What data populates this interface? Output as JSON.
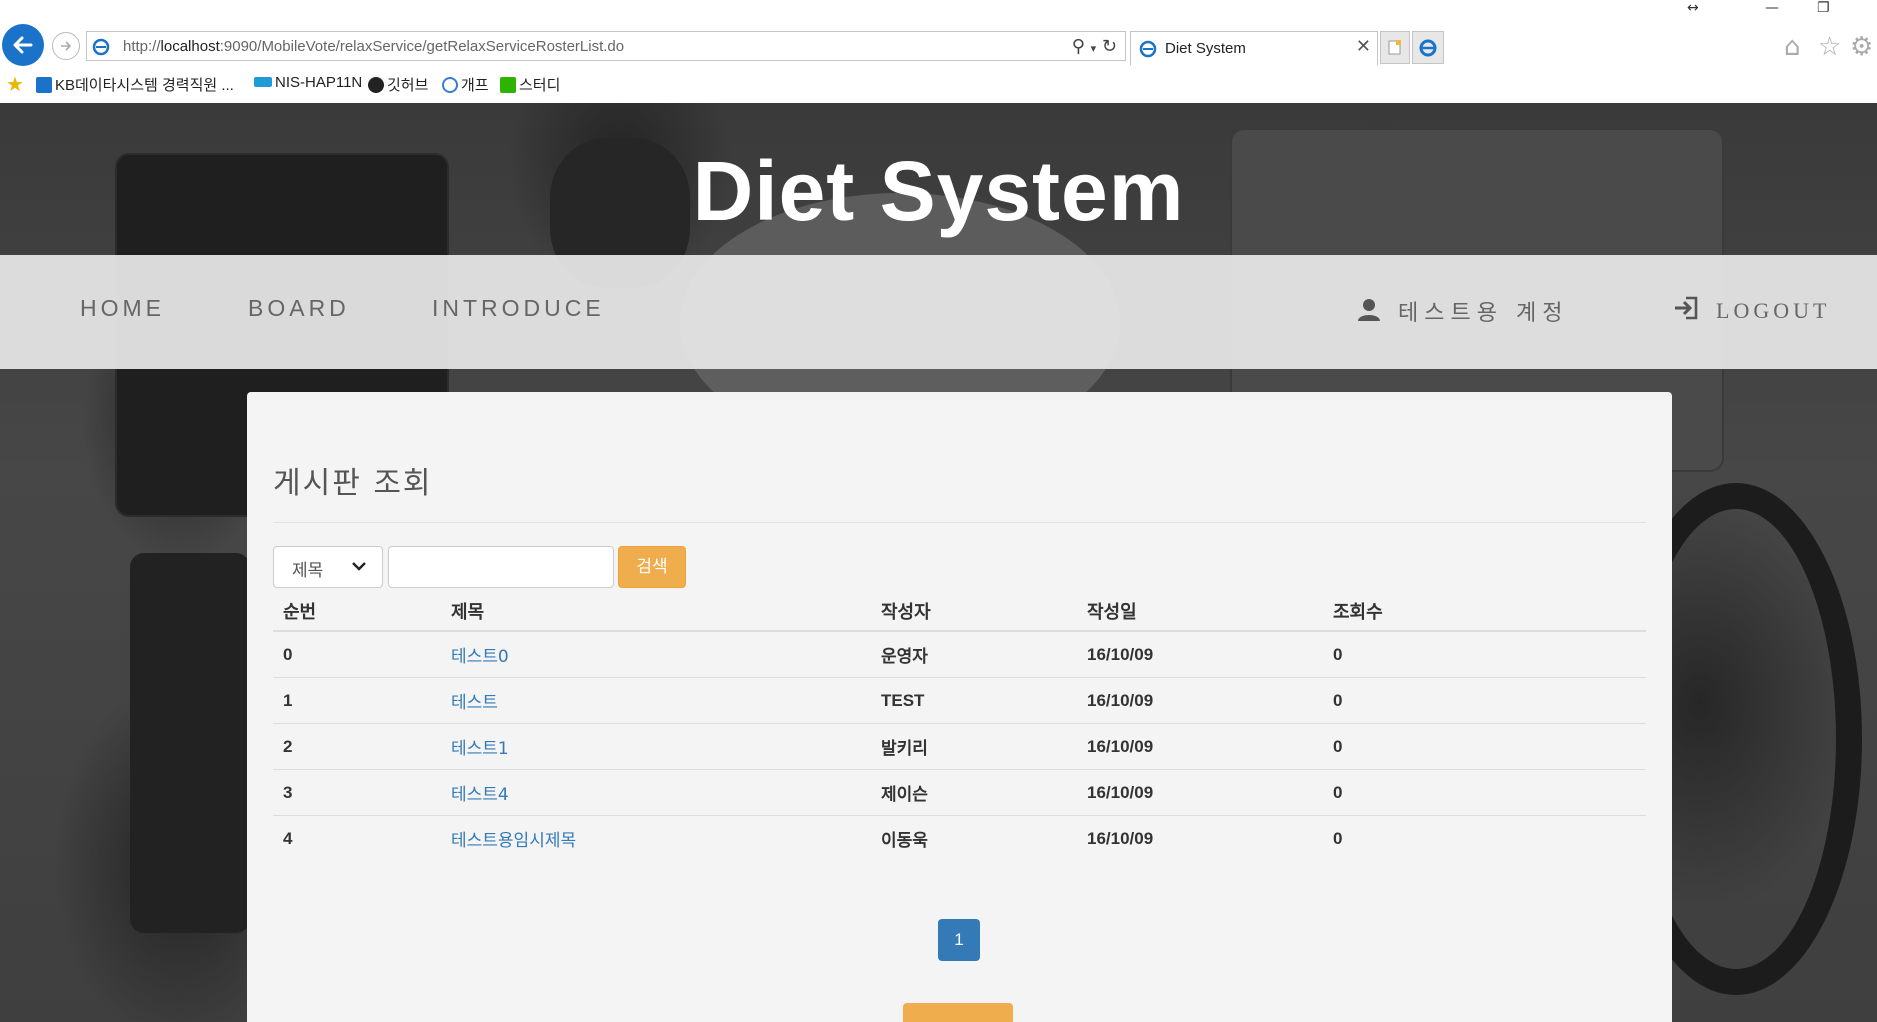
{
  "browser": {
    "url_prefix": "http://",
    "url_host": "localhost",
    "url_rest": ":9090/MobileVote/relaxService/getRelaxServiceRosterList.do",
    "tab_title": "Diet System",
    "favorites": [
      {
        "label": "KB데이타시스템 경력직원 ...",
        "color": "#1a73c8"
      },
      {
        "label": "NIS-HAP11N",
        "color": "#1f9bd7"
      },
      {
        "label": "깃허브",
        "color": "#222222"
      },
      {
        "label": "개프",
        "color": "#3a7bd5"
      },
      {
        "label": "스터디",
        "color": "#2db400"
      }
    ]
  },
  "site": {
    "title": "Diet System",
    "nav": [
      "HOME",
      "BOARD",
      "INTRODUCE"
    ],
    "user": "테스트용 계정",
    "logout": "LOGOUT"
  },
  "board": {
    "heading": "게시판 조회",
    "search_option": "제목",
    "search_button": "검색",
    "columns": [
      "순번",
      "제목",
      "작성자",
      "작성일",
      "조회수"
    ],
    "rows": [
      {
        "no": "0",
        "title": "테스트0",
        "writer": "운영자",
        "date": "16/10/09",
        "views": "0"
      },
      {
        "no": "1",
        "title": "테스트",
        "writer": "TEST",
        "date": "16/10/09",
        "views": "0"
      },
      {
        "no": "2",
        "title": "테스트1",
        "writer": "발키리",
        "date": "16/10/09",
        "views": "0"
      },
      {
        "no": "3",
        "title": "테스트4",
        "writer": "제이슨",
        "date": "16/10/09",
        "views": "0"
      },
      {
        "no": "4",
        "title": "테스트용임시제목",
        "writer": "이동욱",
        "date": "16/10/09",
        "views": "0"
      }
    ],
    "current_page": "1"
  },
  "colors": {
    "accent": "#f0ad4e",
    "link": "#337ab7",
    "pager": "#337ab7"
  }
}
